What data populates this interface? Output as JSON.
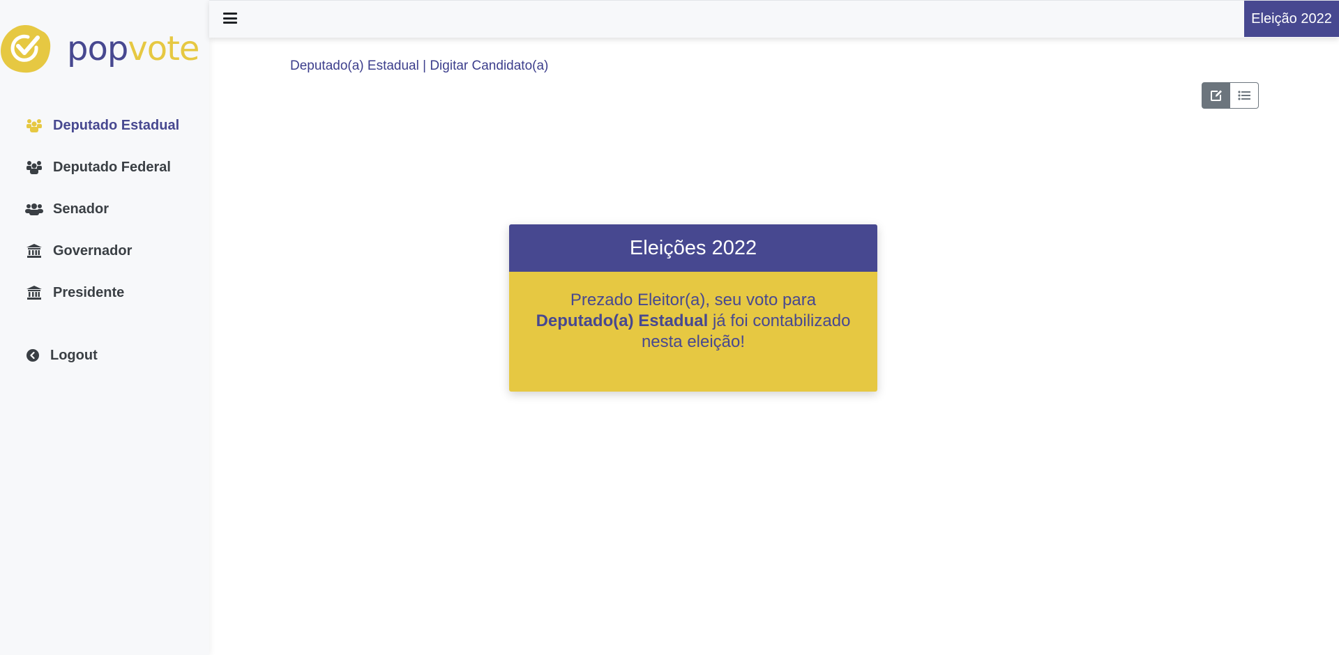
{
  "logo": {
    "part1": "pop",
    "part2": "vote"
  },
  "colors": {
    "primary": "#474890",
    "accent": "#e6c842",
    "sidebar_bg": "#f7f8fa"
  },
  "sidebar": {
    "items": [
      {
        "label": "Deputado Estadual",
        "icon": "users-icon",
        "active": true
      },
      {
        "label": "Deputado Federal",
        "icon": "users-icon",
        "active": false
      },
      {
        "label": "Senador",
        "icon": "users-icon",
        "active": false
      },
      {
        "label": "Governador",
        "icon": "bank-icon",
        "active": false
      },
      {
        "label": "Presidente",
        "icon": "bank-icon",
        "active": false
      }
    ],
    "logout": {
      "label": "Logout",
      "icon": "chevron-circle-left-icon"
    }
  },
  "topbar": {
    "menu_icon": "hamburger-icon",
    "election_badge": "Eleição 2022"
  },
  "breadcrumb": "Deputado(a) Estadual | Digitar Candidato(a)",
  "view_toggle": {
    "edit_icon": "edit-icon",
    "list_icon": "list-icon"
  },
  "card": {
    "title": "Eleições 2022",
    "message_before": "Prezado Eleitor(a), seu voto para ",
    "message_bold": "Deputado(a) Estadual",
    "message_after": " já foi contabilizado nesta eleição!"
  }
}
